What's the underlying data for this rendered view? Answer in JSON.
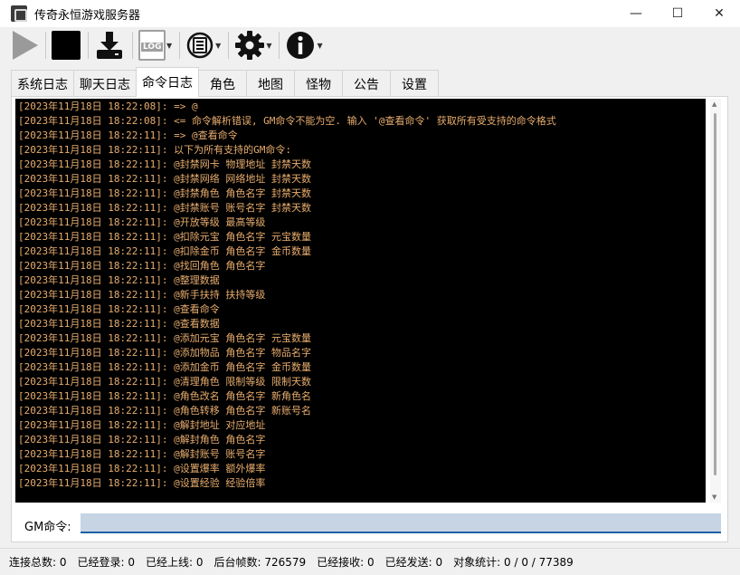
{
  "window": {
    "title": "传奇永恒游戏服务器",
    "minimize": "—",
    "maximize": "☐",
    "close": "✕"
  },
  "toolbar": {
    "buttons": [
      {
        "icon": "play-icon"
      },
      {
        "icon": "stop-icon"
      },
      {
        "icon": "download-icon"
      },
      {
        "icon": "log-icon",
        "label": "LOG"
      },
      {
        "icon": "network-icon"
      },
      {
        "icon": "gear-icon"
      },
      {
        "icon": "info-icon"
      }
    ]
  },
  "tabs": [
    {
      "label": "系统日志",
      "active": false
    },
    {
      "label": "聊天日志",
      "active": false
    },
    {
      "label": "命令日志",
      "active": true
    },
    {
      "label": "角色",
      "active": false
    },
    {
      "label": "地图",
      "active": false
    },
    {
      "label": "怪物",
      "active": false
    },
    {
      "label": "公告",
      "active": false
    },
    {
      "label": "设置",
      "active": false
    }
  ],
  "log_lines": [
    "[2023年11月18日 18:22:08]: => @",
    "[2023年11月18日 18:22:08]: <= 命令解析错误, GM命令不能为空. 输入 '@查看命令' 获取所有受支持的命令格式",
    "[2023年11月18日 18:22:11]: => @查看命令",
    "[2023年11月18日 18:22:11]: 以下为所有支持的GM命令:",
    "[2023年11月18日 18:22:11]: @封禁网卡 物理地址 封禁天数",
    "[2023年11月18日 18:22:11]: @封禁网络 网络地址 封禁天数",
    "[2023年11月18日 18:22:11]: @封禁角色 角色名字 封禁天数",
    "[2023年11月18日 18:22:11]: @封禁账号 账号名字 封禁天数",
    "[2023年11月18日 18:22:11]: @开放等级 最高等级",
    "[2023年11月18日 18:22:11]: @扣除元宝 角色名字 元宝数量",
    "[2023年11月18日 18:22:11]: @扣除金币 角色名字 金币数量",
    "[2023年11月18日 18:22:11]: @找回角色 角色名字",
    "[2023年11月18日 18:22:11]: @整理数据",
    "[2023年11月18日 18:22:11]: @新手扶持 扶持等级",
    "[2023年11月18日 18:22:11]: @查看命令",
    "[2023年11月18日 18:22:11]: @查看数据",
    "[2023年11月18日 18:22:11]: @添加元宝 角色名字 元宝数量",
    "[2023年11月18日 18:22:11]: @添加物品 角色名字 物品名字",
    "[2023年11月18日 18:22:11]: @添加金币 角色名字 金币数量",
    "[2023年11月18日 18:22:11]: @清理角色 限制等级 限制天数",
    "[2023年11月18日 18:22:11]: @角色改名 角色名字 新角色名",
    "[2023年11月18日 18:22:11]: @角色转移 角色名字 新账号名",
    "[2023年11月18日 18:22:11]: @解封地址 对应地址",
    "[2023年11月18日 18:22:11]: @解封角色 角色名字",
    "[2023年11月18日 18:22:11]: @解封账号 账号名字",
    "[2023年11月18日 18:22:11]: @设置爆率 额外爆率",
    "[2023年11月18日 18:22:11]: @设置经验 经验倍率"
  ],
  "gm_command": {
    "label": "GM命令:",
    "value": ""
  },
  "status": [
    "连接总数: 0",
    "已经登录: 0",
    "已经上线: 0",
    "后台帧数: 726579",
    "已经接收: 0",
    "已经发送: 0",
    "对象统计: 0 / 0 / 77389"
  ],
  "colors": {
    "log_text": "#e8ad6e",
    "console_bg": "#000000",
    "input_bg": "#c6d4e3",
    "input_underline": "#1f5fa8"
  }
}
